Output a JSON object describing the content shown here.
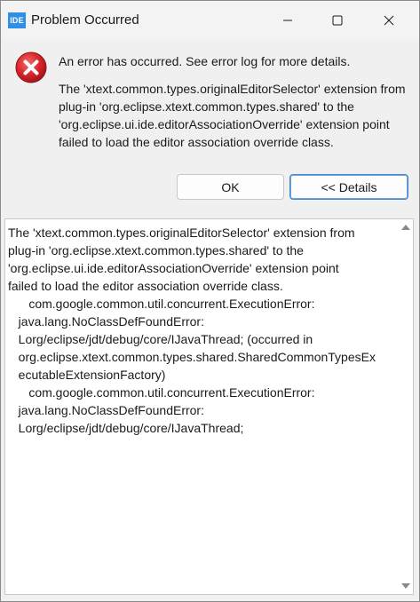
{
  "window": {
    "app_icon_text": "IDE",
    "title": "Problem Occurred"
  },
  "message": {
    "headline": "An error has occurred. See error log for more details.",
    "detail": "The 'xtext.common.types.originalEditorSelector' extension from plug-in 'org.eclipse.xtext.common.types.shared' to the 'org.eclipse.ui.ide.editorAssociationOverride' extension point failed to load the editor association override class."
  },
  "buttons": {
    "ok_label": "OK",
    "details_label": "<< Details"
  },
  "details": {
    "text": "The 'xtext.common.types.originalEditorSelector' extension from\nplug-in 'org.eclipse.xtext.common.types.shared' to the\n'org.eclipse.ui.ide.editorAssociationOverride' extension point\nfailed to load the editor association override class.\n      com.google.common.util.concurrent.ExecutionError:\n   java.lang.NoClassDefFoundError:\n   Lorg/eclipse/jdt/debug/core/IJavaThread; (occurred in\n   org.eclipse.xtext.common.types.shared.SharedCommonTypesEx\n   ecutableExtensionFactory)\n      com.google.common.util.concurrent.ExecutionError:\n   java.lang.NoClassDefFoundError:\n   Lorg/eclipse/jdt/debug/core/IJavaThread;"
  },
  "icons": {
    "app": "ide-app-icon",
    "error": "error-icon",
    "minimize": "minimize-icon",
    "maximize": "maximize-icon",
    "close": "close-icon"
  },
  "colors": {
    "error_red": "#d9252a",
    "accent_border": "#4a88c9",
    "app_icon_blue": "#2f8fe6"
  }
}
